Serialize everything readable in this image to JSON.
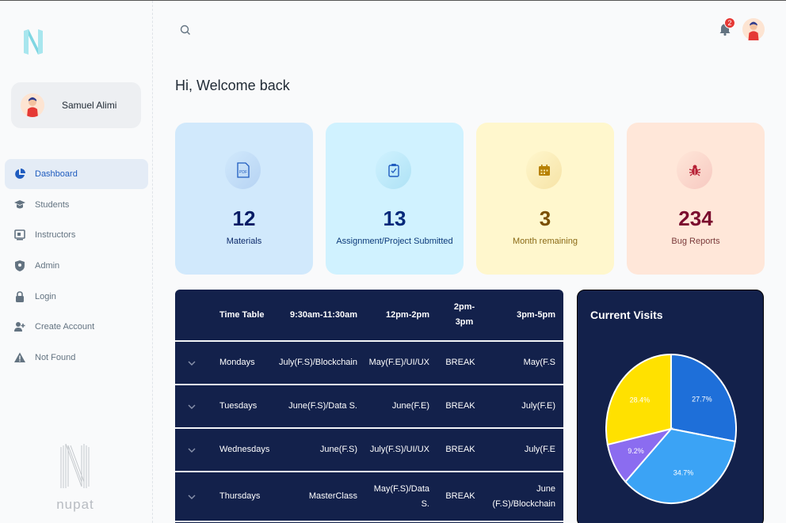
{
  "brand": {
    "logo_text": "nupat"
  },
  "user": {
    "name": "Samuel Alimi"
  },
  "nav": [
    {
      "label": "Dashboard",
      "icon": "pie-chart-icon",
      "active": true
    },
    {
      "label": "Students",
      "icon": "graduation-cap-icon"
    },
    {
      "label": "Instructors",
      "icon": "presentation-icon"
    },
    {
      "label": "Admin",
      "icon": "shield-icon"
    },
    {
      "label": "Login",
      "icon": "lock-icon"
    },
    {
      "label": "Create Account",
      "icon": "add-user-icon"
    },
    {
      "label": "Not Found",
      "icon": "warning-icon"
    }
  ],
  "header": {
    "notification_count": "2"
  },
  "welcome": "Hi, Welcome back",
  "cards": [
    {
      "value": "12",
      "label": "Materials",
      "icon": "pdf-icon",
      "bg": "#d1e9fc",
      "icon_bg": "#b6d3f3",
      "color": "#061b64",
      "label_color": "#0c2a6a"
    },
    {
      "value": "13",
      "label": "Assignment/Project Submitted",
      "icon": "clipboard-check-icon",
      "bg": "#d0f2ff",
      "icon_bg": "#aee2f5",
      "color": "#04297a",
      "label_color": "#0c3a7a"
    },
    {
      "value": "3",
      "label": "Month remaining",
      "icon": "calendar-icon",
      "bg": "#fff7cd",
      "icon_bg": "#f6e3a6",
      "color": "#7a4f01",
      "label_color": "#8a6a16"
    },
    {
      "value": "234",
      "label": "Bug Reports",
      "icon": "bug-icon",
      "bg": "#ffe7d9",
      "icon_bg": "#f7c9c1",
      "color": "#7a0c2e",
      "label_color": "#7a3a3a"
    }
  ],
  "timetable": {
    "headers": [
      "Time Table",
      "9:30am-11:30am",
      "12pm-2pm",
      "2pm-3pm",
      "3pm-5pm"
    ],
    "rows": [
      {
        "day": "Mondays",
        "c1": "July(F.S)/Blockchain",
        "c2": "May(F.E)/UI/UX",
        "c3": "BREAK",
        "c4": "May(F.S"
      },
      {
        "day": "Tuesdays",
        "c1": "June(F.S)/Data S.",
        "c2": "June(F.E)",
        "c3": "BREAK",
        "c4": "July(F.E)"
      },
      {
        "day": "Wednesdays",
        "c1": "June(F.S)",
        "c2": "July(F.S)/UI/UX",
        "c3": "BREAK",
        "c4": "July(F.E"
      },
      {
        "day": "Thursdays",
        "c1": "MasterClass",
        "c2": "May(F.S)/Data S.",
        "c3": "BREAK",
        "c4": "June (F.S)/Blockchain"
      }
    ]
  },
  "visits": {
    "title": "Current Visits"
  },
  "chart_data": {
    "type": "pie",
    "title": "Current Visits",
    "slices": [
      {
        "value": 27.7,
        "label": "27.7%",
        "color": "#1e6fd9"
      },
      {
        "value": 34.7,
        "label": "34.7%",
        "color": "#3ba3f5"
      },
      {
        "value": 9.2,
        "label": "9.2%",
        "color": "#8b6cf0"
      },
      {
        "value": 28.4,
        "label": "28.4%",
        "color": "#ffe100"
      }
    ]
  }
}
